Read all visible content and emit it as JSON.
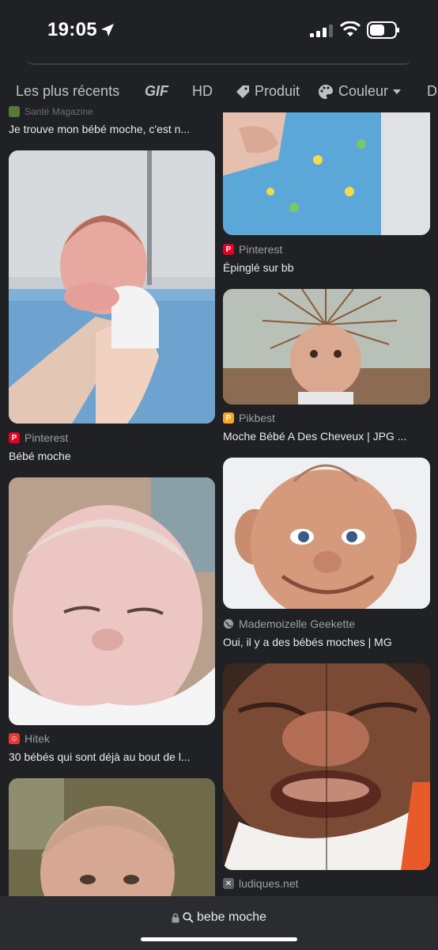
{
  "status": {
    "time": "19:05"
  },
  "filters": [
    {
      "label": "Les plus récents"
    },
    {
      "label": "GIF"
    },
    {
      "label": "HD"
    },
    {
      "label": "Produit",
      "icon": "tag-icon"
    },
    {
      "label": "Couleur",
      "icon": "palette-icon"
    },
    {
      "label": "D"
    }
  ],
  "results": {
    "left": [
      {
        "source": "Santé Magazine",
        "caption": "Je trouve mon bébé moche, c'est n...",
        "favicon_color": "#7cb342"
      },
      {
        "source": "Pinterest",
        "caption": "Bébé moche",
        "favicon_color": "#e60023"
      },
      {
        "source": "Hitek",
        "caption": "30 bébés qui sont déjà au bout de l...",
        "favicon_color": "#e53935"
      }
    ],
    "right": [
      {
        "source": "Pinterest",
        "caption": "Épinglé sur bb",
        "favicon_color": "#e60023"
      },
      {
        "source": "Pikbest",
        "caption": "Moche Bébé A Des Cheveux | JPG ...",
        "favicon_color": "#f9a825"
      },
      {
        "source": "Mademoizelle Geekette",
        "caption": "Oui, il y a des bébés moches | MG",
        "favicon_color": "#9aa0a6"
      },
      {
        "source": "ludiques.net",
        "caption": "",
        "favicon_color": "#9aa0a6"
      }
    ]
  },
  "bottom": {
    "query": "bebe moche"
  }
}
